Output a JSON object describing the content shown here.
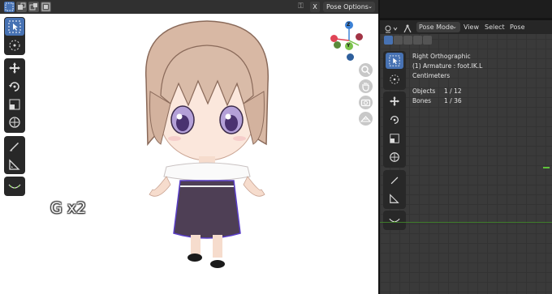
{
  "left_view": {
    "header": {
      "lock_icon": "lock-icon",
      "close_label": "X",
      "pose_options_label": "Pose Options",
      "dropdown_icon": "chevron-down-icon"
    },
    "toolbar": [
      "select-box-tool",
      "cursor-tool",
      "move-tool",
      "rotate-tool",
      "scale-tool",
      "transform-tool",
      "annotate-tool",
      "measure-tool",
      "relax-pose-tool"
    ],
    "gizmo": {
      "x_color": "#e04456",
      "y_color": "#7bc24b",
      "z_color": "#3d82d6",
      "z_label": "Z",
      "y_label": "Y"
    },
    "nav_buttons": [
      "zoom-icon",
      "hand-icon",
      "camera-icon",
      "grid-icon"
    ],
    "overlay_caption": "G x2"
  },
  "right_view": {
    "header": {
      "mode": "Pose Mode",
      "menu": [
        "View",
        "Select",
        "Pose"
      ]
    },
    "info": {
      "view_name": "Right Orthographic",
      "armature_line": "(1) Armature : foot.IK.L",
      "units": "Centimeters",
      "objects_label": "Objects",
      "objects_value": "1 / 12",
      "bones_label": "Bones",
      "bones_value": "1 / 36"
    }
  },
  "colors": {
    "accent": "#4772b3",
    "header_bg": "#303030",
    "grid_bg": "#3a3a3a"
  }
}
